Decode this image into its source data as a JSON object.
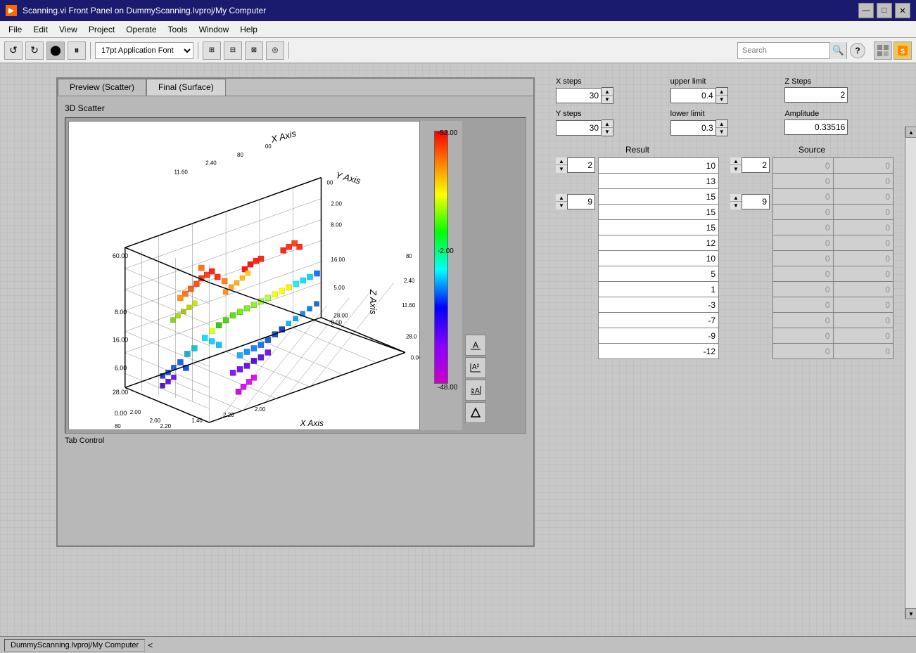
{
  "window": {
    "title": "Scanning.vi Front Panel on DummyScanning.lvproj/My Computer",
    "icon": "▶"
  },
  "titlebar": {
    "title": "Scanning.vi Front Panel on DummyScanning.lvproj/My Computer",
    "min_btn": "—",
    "max_btn": "□",
    "close_btn": "✕"
  },
  "menu": {
    "items": [
      "File",
      "Edit",
      "View",
      "Project",
      "Operate",
      "Tools",
      "Window",
      "Help"
    ]
  },
  "toolbar": {
    "font_selector": "17pt Application Font",
    "search_placeholder": "Search"
  },
  "tabs": [
    {
      "label": "Preview (Scatter)",
      "active": true
    },
    {
      "label": "Final (Surface)",
      "active": false
    }
  ],
  "scatter_plot": {
    "title": "3D Scatter",
    "color_bar": {
      "top_value": "-52.00",
      "mid_value": "-2.00",
      "bot_value": "-48.00"
    }
  },
  "parameters": {
    "x_steps": {
      "label": "X steps",
      "value": "30"
    },
    "upper_limit": {
      "label": "upper limit",
      "value": "0.4"
    },
    "z_steps": {
      "label": "Z Steps",
      "value": "2"
    },
    "y_steps": {
      "label": "Y steps",
      "value": "30"
    },
    "lower_limit": {
      "label": "lower limit",
      "value": "0.3"
    },
    "amplitude": {
      "label": "Amplitude",
      "value": "0.33516"
    }
  },
  "result_panel": {
    "header": "Result",
    "row1_spinner": "2",
    "row2_spinner": "9",
    "values": [
      "10",
      "13",
      "15",
      "15",
      "15",
      "12",
      "10",
      "5",
      "1",
      "-3",
      "-7",
      "-9",
      "-12"
    ]
  },
  "source_panel": {
    "header": "Source",
    "row1_spinner": "2",
    "row2_spinner": "9",
    "values": [
      "0",
      "0",
      "0",
      "0",
      "0",
      "0",
      "0",
      "0",
      "0",
      "0",
      "0",
      "0",
      "0"
    ]
  },
  "tab_control_label": "Tab Control",
  "status_bar": {
    "project_label": "DummyScanning.lvproj/My Computer",
    "arrow": "<"
  }
}
